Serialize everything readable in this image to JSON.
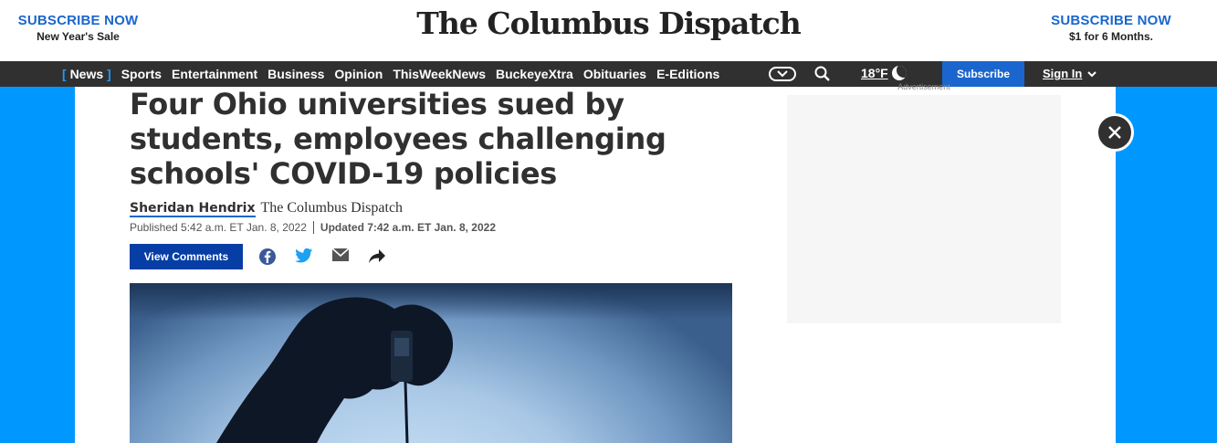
{
  "promo_left": {
    "headline": "SUBSCRIBE NOW",
    "subline": "New Year's Sale"
  },
  "masthead": "The Columbus Dispatch",
  "promo_right": {
    "headline": "SUBSCRIBE NOW",
    "subline": "$1 for 6 Months."
  },
  "nav": {
    "items": [
      "News",
      "Sports",
      "Entertainment",
      "Business",
      "Opinion",
      "ThisWeekNews",
      "BuckeyeXtra",
      "Obituaries",
      "E-Editions"
    ],
    "active_bracket_left": "[",
    "active_bracket_right": "]",
    "weather": "18°F",
    "subscribe": "Subscribe",
    "sign_in": "Sign In"
  },
  "ad_label": "Advertisement",
  "article": {
    "headline": "Four Ohio universities sued by students, employees challenging schools' COVID-19 policies",
    "author": "Sheridan Hendrix",
    "outlet": "The Columbus Dispatch",
    "published": "Published 5:42 a.m. ET Jan. 8, 2022",
    "updated": "Updated 7:42 a.m. ET Jan. 8, 2022",
    "view_comments": "View Comments"
  },
  "icons": {
    "share": [
      "facebook-icon",
      "twitter-icon",
      "email-icon",
      "share-icon"
    ],
    "search": "search-icon",
    "weather": "moon-icon",
    "close": "close-icon"
  },
  "colors": {
    "brand_blue": "#1a66ce",
    "page_bg": "#0098ff",
    "nav_bg": "#303030",
    "button_blue": "#063ea5"
  }
}
